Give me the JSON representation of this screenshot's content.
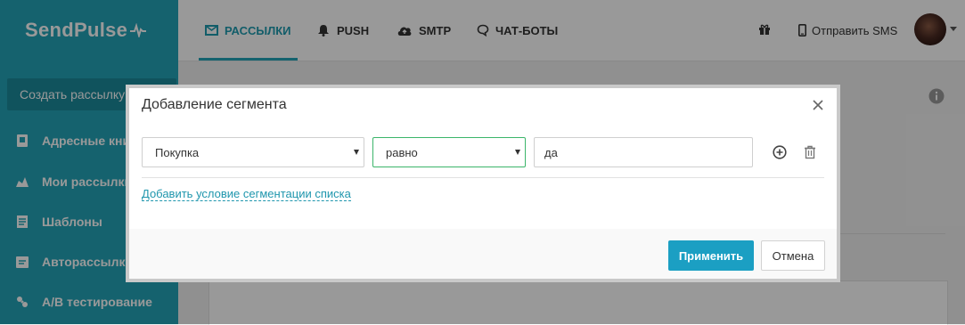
{
  "brand": {
    "name": "SendPulse"
  },
  "sidebar": {
    "create_button": "Создать рассылку",
    "items": [
      {
        "label": "Адресные книги",
        "icon": "address-book-icon"
      },
      {
        "label": "Мои рассылки",
        "icon": "campaigns-icon"
      },
      {
        "label": "Шаблоны",
        "icon": "templates-icon"
      },
      {
        "label": "Авторассылки",
        "icon": "automation-icon"
      },
      {
        "label": "A/B тестирование",
        "icon": "ab-test-icon"
      }
    ]
  },
  "header": {
    "tabs": [
      {
        "label": "РАССЫЛКИ",
        "icon": "envelope-icon",
        "active": true
      },
      {
        "label": "PUSH",
        "icon": "bell-icon"
      },
      {
        "label": "SMTP",
        "icon": "cloud-upload-icon"
      },
      {
        "label": "ЧАТ-БОТЫ",
        "icon": "chat-bubble-icon"
      }
    ],
    "gift_icon": "gift-icon",
    "sms_label": "Отправить SMS",
    "sms_icon": "phone-icon"
  },
  "modal": {
    "title": "Добавление сегмента",
    "condition": {
      "field_value": "Покупка",
      "operator_value": "равно",
      "value_text": "да"
    },
    "add_condition_link": "Добавить условие сегментации списка",
    "apply_button": "Применить",
    "cancel_button": "Отмена"
  },
  "colors": {
    "brand": "#23a3b8",
    "primary_button": "#1b9fc3",
    "focus_border": "#3bb56a",
    "link": "#1f96ad"
  }
}
